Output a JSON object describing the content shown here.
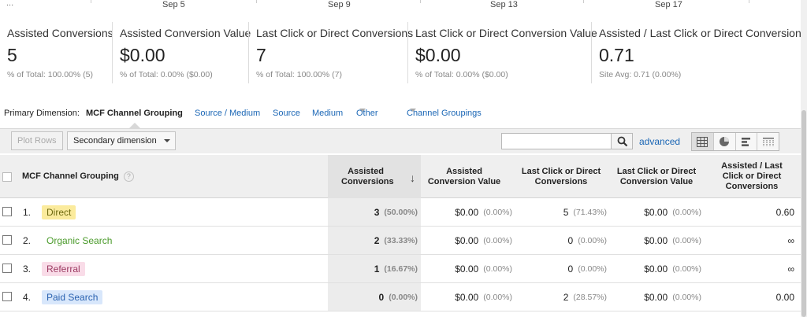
{
  "timeline": {
    "dots": "...",
    "dates": [
      "Sep 5",
      "Sep 9",
      "Sep 13",
      "Sep 17"
    ]
  },
  "scorecards": [
    {
      "label": "Assisted Conversions",
      "value": "5",
      "sub": "% of Total: 100.00% (5)"
    },
    {
      "label": "Assisted Conversion Value",
      "value": "$0.00",
      "sub": "% of Total: 0.00% ($0.00)"
    },
    {
      "label": "Last Click or Direct Conversions",
      "value": "7",
      "sub": "% of Total: 100.00% (7)"
    },
    {
      "label": "Last Click or Direct Conversion Value",
      "value": "$0.00",
      "sub": "% of Total: 0.00% ($0.00)"
    },
    {
      "label": "Assisted / Last Click or Direct Conversions",
      "value": "0.71",
      "sub": "Site Avg: 0.71 (0.00%)"
    }
  ],
  "dimensions": {
    "label": "Primary Dimension:",
    "active": "MCF Channel Grouping",
    "links": [
      "Source / Medium",
      "Source",
      "Medium"
    ],
    "other": "Other",
    "channel_groupings": "Channel Groupings"
  },
  "toolbar": {
    "plot_rows": "Plot Rows",
    "secondary_dimension": "Secondary dimension",
    "search_placeholder": "",
    "advanced": "advanced"
  },
  "table": {
    "headers": {
      "dimension": "MCF Channel Grouping",
      "help": "?",
      "sort_arrow": "↓",
      "assisted_conversions": "Assisted Conversions",
      "assisted_conversion_value": "Assisted Conversion Value",
      "last_click_conversions": "Last Click or Direct Conversions",
      "last_click_value": "Last Click or Direct Conversion Value",
      "ratio": "Assisted / Last Click or Direct Conversions"
    },
    "rows": [
      {
        "index": "1.",
        "channel": "Direct",
        "color_bg": "#fbeb9d",
        "color_fg": "#6f6a10",
        "assisted": "3",
        "assisted_pct": "(50.00%)",
        "assisted_value": "$0.00",
        "assisted_value_pct": "(0.00%)",
        "last_click": "5",
        "last_click_pct": "(71.43%)",
        "last_value": "$0.00",
        "last_value_pct": "(0.00%)",
        "ratio": "0.60"
      },
      {
        "index": "2.",
        "channel": "Organic Search",
        "color_bg": "#ffffff",
        "color_fg": "#4a9a2a",
        "assisted": "2",
        "assisted_pct": "(33.33%)",
        "assisted_value": "$0.00",
        "assisted_value_pct": "(0.00%)",
        "last_click": "0",
        "last_click_pct": "(0.00%)",
        "last_value": "$0.00",
        "last_value_pct": "(0.00%)",
        "ratio": "∞"
      },
      {
        "index": "3.",
        "channel": "Referral",
        "color_bg": "#f9dce8",
        "color_fg": "#9c3a62",
        "assisted": "1",
        "assisted_pct": "(16.67%)",
        "assisted_value": "$0.00",
        "assisted_value_pct": "(0.00%)",
        "last_click": "0",
        "last_click_pct": "(0.00%)",
        "last_value": "$0.00",
        "last_value_pct": "(0.00%)",
        "ratio": "∞"
      },
      {
        "index": "4.",
        "channel": "Paid Search",
        "color_bg": "#d8e7fb",
        "color_fg": "#2a62b0",
        "assisted": "0",
        "assisted_pct": "(0.00%)",
        "assisted_value": "$0.00",
        "assisted_value_pct": "(0.00%)",
        "last_click": "2",
        "last_click_pct": "(28.57%)",
        "last_value": "$0.00",
        "last_value_pct": "(0.00%)",
        "ratio": "0.00"
      }
    ]
  },
  "colors": {
    "link": "#1a66b5",
    "header_bg": "#efefef",
    "sorted_col_bg": "#ececec"
  }
}
